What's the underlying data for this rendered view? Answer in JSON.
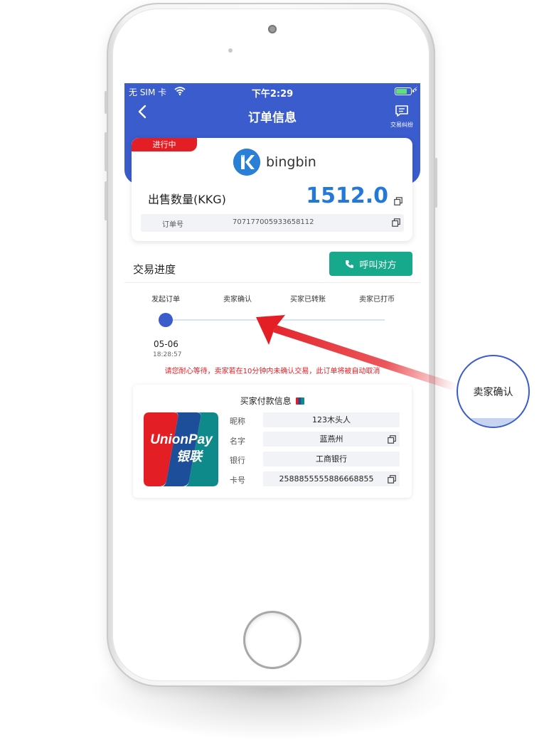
{
  "status_bar": {
    "carrier": "无 SIM 卡",
    "time": "下午2:29",
    "battery_level": 0.8
  },
  "nav": {
    "title": "订单信息",
    "dispute_label": "交易纠纷"
  },
  "order": {
    "status_tag": "进行中",
    "merchant_name": "bingbin",
    "quantity_label": "出售数量(KKG)",
    "quantity_value": "1512.0",
    "order_no_label": "订单号",
    "order_no_value": "707177005933658112"
  },
  "progress": {
    "title": "交易进度",
    "call_button": "呼叫对方",
    "steps": [
      "发起订单",
      "卖家确认",
      "买家已转账",
      "卖家已打币"
    ],
    "current_step": 1,
    "date": "05-06",
    "time": "18:28:57",
    "notice": "请您耐心等待，卖家若在10分钟内未确认交易，此订单将被自动取消"
  },
  "payment": {
    "title": "买家付款信息",
    "card_brand_en": "UnionPay",
    "card_brand_cn": "银联",
    "fields": [
      {
        "label": "昵称",
        "value": "123木头人"
      },
      {
        "label": "名字",
        "value": "蓝燕州"
      },
      {
        "label": "银行",
        "value": "工商银行"
      },
      {
        "label": "卡号",
        "value": "2588855555886668855"
      }
    ]
  },
  "callout": {
    "text": "卖家确认"
  },
  "colors": {
    "brand_blue": "#3a5ccc",
    "accent_red": "#e31e24",
    "call_green": "#17a98c",
    "amount_blue": "#2378d8"
  }
}
